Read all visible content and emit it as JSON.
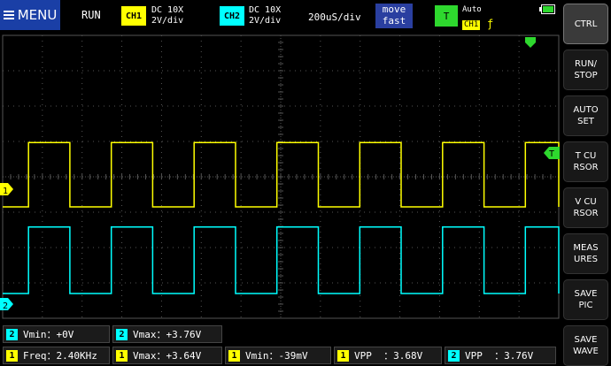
{
  "header": {
    "menu_label": "MENU",
    "run_status": "RUN",
    "ch1": {
      "badge": "CH1",
      "coupling": "DC 10X",
      "scale": "2V/div",
      "color": "#ffff00"
    },
    "ch2": {
      "badge": "CH2",
      "coupling": "DC 10X",
      "scale": "2V/div",
      "color": "#00ffff"
    },
    "timebase": "200uS/div",
    "move_line1": "move",
    "move_line2": "fast",
    "trigger": {
      "badge": "T",
      "mode": "Auto",
      "source": "CH1",
      "edge_icon": "rising-edge-icon",
      "color": "#2ed82e"
    },
    "battery_icon": "battery-icon"
  },
  "sidebar": {
    "items": [
      {
        "line1": "CTRL",
        "line2": ""
      },
      {
        "line1": "RUN/",
        "line2": "STOP"
      },
      {
        "line1": "AUTO",
        "line2": "SET"
      },
      {
        "line1": "T CU",
        "line2": "RSOR"
      },
      {
        "line1": "V CU",
        "line2": "RSOR"
      },
      {
        "line1": "MEAS",
        "line2": "URES"
      },
      {
        "line1": "SAVE",
        "line2": "PIC"
      },
      {
        "line1": "SAVE",
        "line2": "WAVE"
      }
    ]
  },
  "plot": {
    "ch1_marker": "1",
    "ch2_marker": "2",
    "trigger_marker": "T",
    "grid_color": "#555555",
    "ch1": {
      "low_v": 0,
      "high_v": 3.64,
      "period_us": 417,
      "duty": 0.5
    },
    "ch2": {
      "low_v": 0,
      "high_v": 3.76,
      "period_us": 417,
      "duty": 0.5
    }
  },
  "measurements": {
    "row1": [
      {
        "ch": "2",
        "text": "Vmin：+0V"
      },
      {
        "ch": "2",
        "text": "Vmax：+3.76V"
      }
    ],
    "row2": [
      {
        "ch": "1",
        "text": "Freq：2.40KHz"
      },
      {
        "ch": "1",
        "text": "Vmax：+3.64V"
      },
      {
        "ch": "1",
        "text": "Vmin：-39mV"
      },
      {
        "ch": "1",
        "text": "VPP  ：3.68V"
      },
      {
        "ch": "2",
        "text": "VPP  ：3.76V"
      }
    ]
  }
}
